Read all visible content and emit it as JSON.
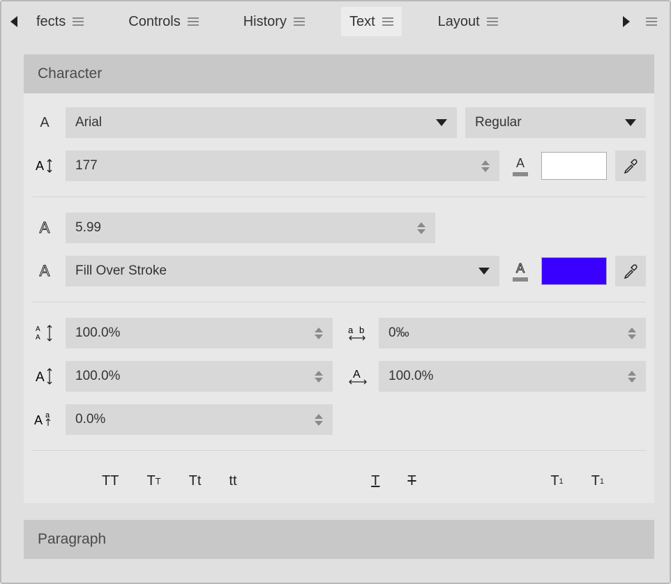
{
  "tabs": {
    "scroll_prev_icon": "chevron-left-icon",
    "scroll_next_icon": "chevron-right-icon",
    "items": [
      {
        "label": "fects",
        "active": false
      },
      {
        "label": "Controls",
        "active": false
      },
      {
        "label": "History",
        "active": false
      },
      {
        "label": "Text",
        "active": true
      },
      {
        "label": "Layout",
        "active": false
      }
    ]
  },
  "character": {
    "section_title": "Character",
    "font_family": "Arial",
    "font_style": "Regular",
    "font_size": "177",
    "fill_color": "#ffffff",
    "stroke_width": "5.99",
    "stroke_order": "Fill Over Stroke",
    "stroke_color": "#3a00ff",
    "line_spacing": "100.0%",
    "tracking": "0‰",
    "vertical_scale": "100.0%",
    "horizontal_scale": "100.0%",
    "baseline_shift": "0.0%",
    "case_buttons": {
      "all_caps": "TT",
      "small_caps_label": "T",
      "small_caps_small": "T",
      "title_case": "Tt",
      "lower_case": "tt",
      "underline": "T",
      "strikethrough": "T",
      "superscript": "T",
      "superscript_mark": "1",
      "subscript": "T",
      "subscript_mark": "1"
    }
  },
  "paragraph": {
    "section_title": "Paragraph"
  }
}
